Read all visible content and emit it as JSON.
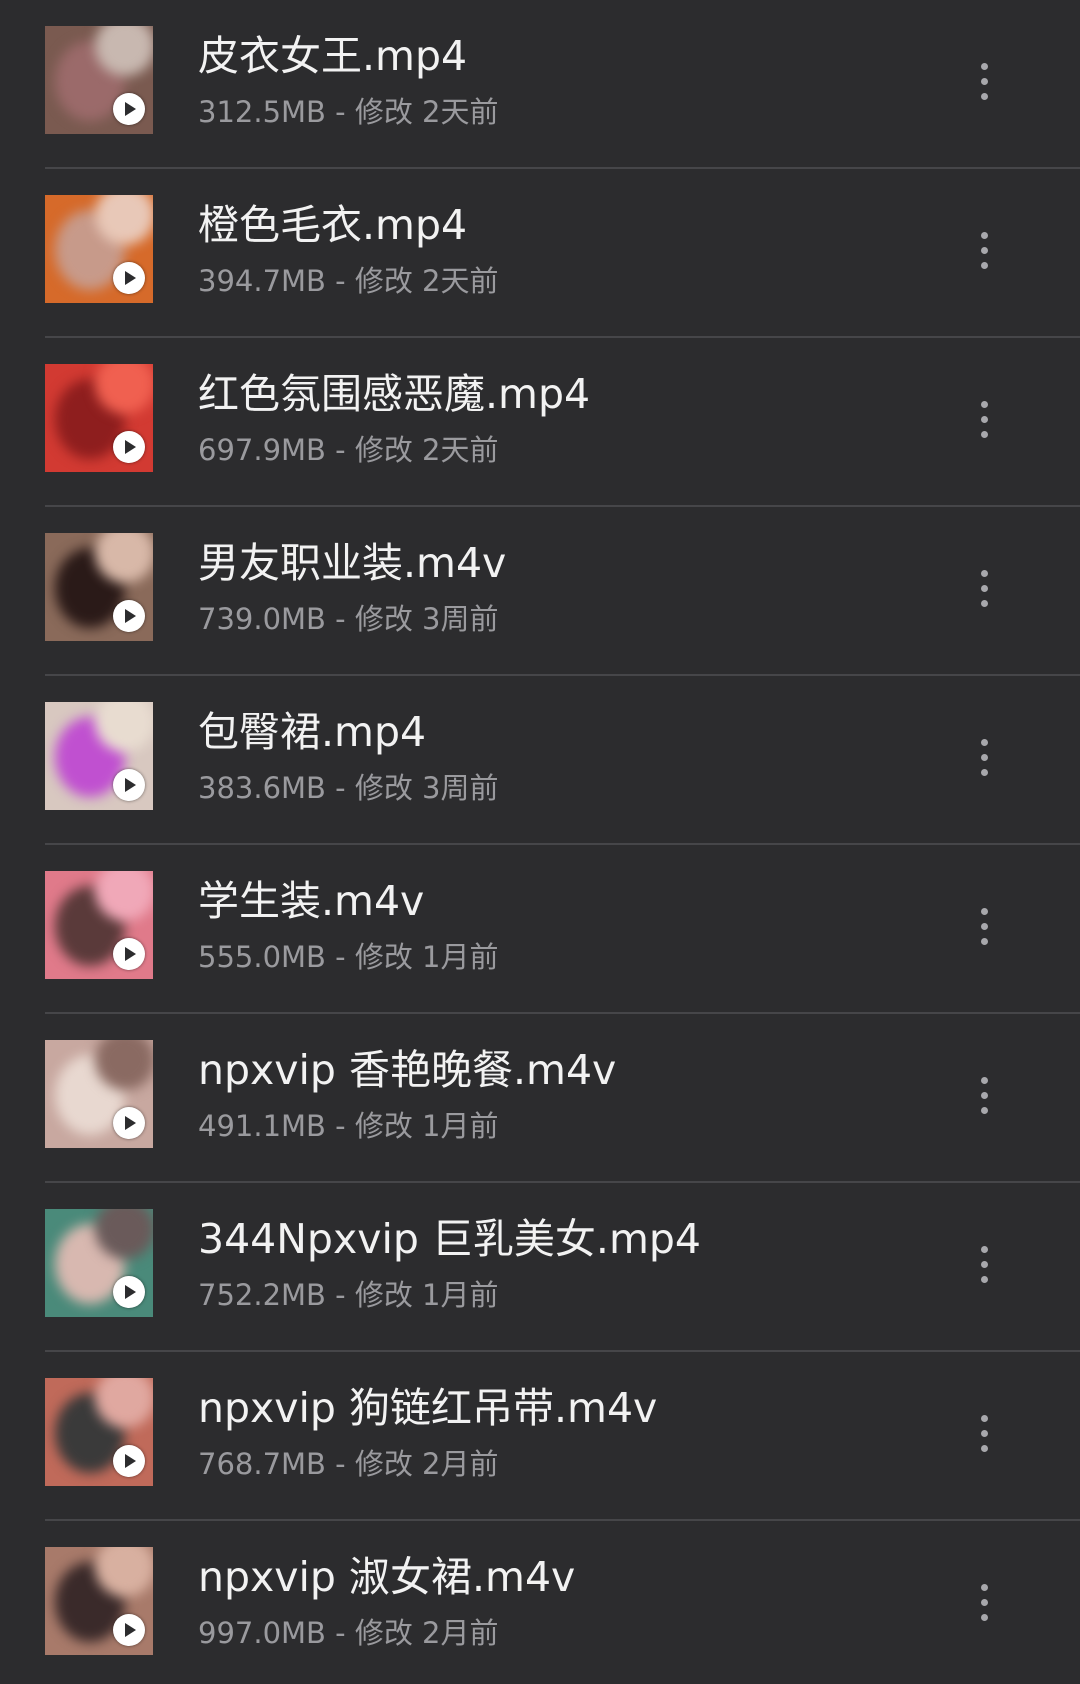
{
  "files": [
    {
      "name": "皮衣女王.mp4",
      "meta": "312.5MB - 修改 2天前",
      "thumb_colors": [
        "#7a5a50",
        "#9b6a6a",
        "#c8b8b0"
      ]
    },
    {
      "name": "橙色毛衣.mp4",
      "meta": "394.7MB - 修改 2天前",
      "thumb_colors": [
        "#d66a2a",
        "#c79a8a",
        "#e8c8b8"
      ]
    },
    {
      "name": "红色氛围感恶魔.mp4",
      "meta": "697.9MB - 修改 2天前",
      "thumb_colors": [
        "#d23a32",
        "#8e1e1e",
        "#f06050"
      ]
    },
    {
      "name": "男友职业装.m4v",
      "meta": "739.0MB - 修改 3周前",
      "thumb_colors": [
        "#8a6a5a",
        "#2a1a18",
        "#d8b8a8"
      ]
    },
    {
      "name": "包臀裙.mp4",
      "meta": "383.6MB - 修改 3周前",
      "thumb_colors": [
        "#d8c8c0",
        "#c050d0",
        "#e8dcd0"
      ]
    },
    {
      "name": "学生装.m4v",
      "meta": "555.0MB - 修改 1月前",
      "thumb_colors": [
        "#e07a8a",
        "#5a3a3a",
        "#f0a8b8"
      ]
    },
    {
      "name": "npxvip  香艳晚餐.m4v",
      "meta": "491.1MB - 修改 1月前",
      "thumb_colors": [
        "#c8a8a0",
        "#e8d8d0",
        "#8a6a62"
      ]
    },
    {
      "name": "344Npxvip 巨乳美女.mp4",
      "meta": "752.2MB - 修改 1月前",
      "thumb_colors": [
        "#4a8a7a",
        "#d8b8b0",
        "#6a5a5a"
      ]
    },
    {
      "name": "npxvip  狗链红吊带.m4v",
      "meta": "768.7MB - 修改 2月前",
      "thumb_colors": [
        "#c06a5a",
        "#3a3a3a",
        "#e0a8a0"
      ]
    },
    {
      "name": "npxvip  淑女裙.m4v",
      "meta": "997.0MB - 修改 2月前",
      "thumb_colors": [
        "#a87a6a",
        "#3a2a2a",
        "#d8b0a0"
      ]
    }
  ]
}
